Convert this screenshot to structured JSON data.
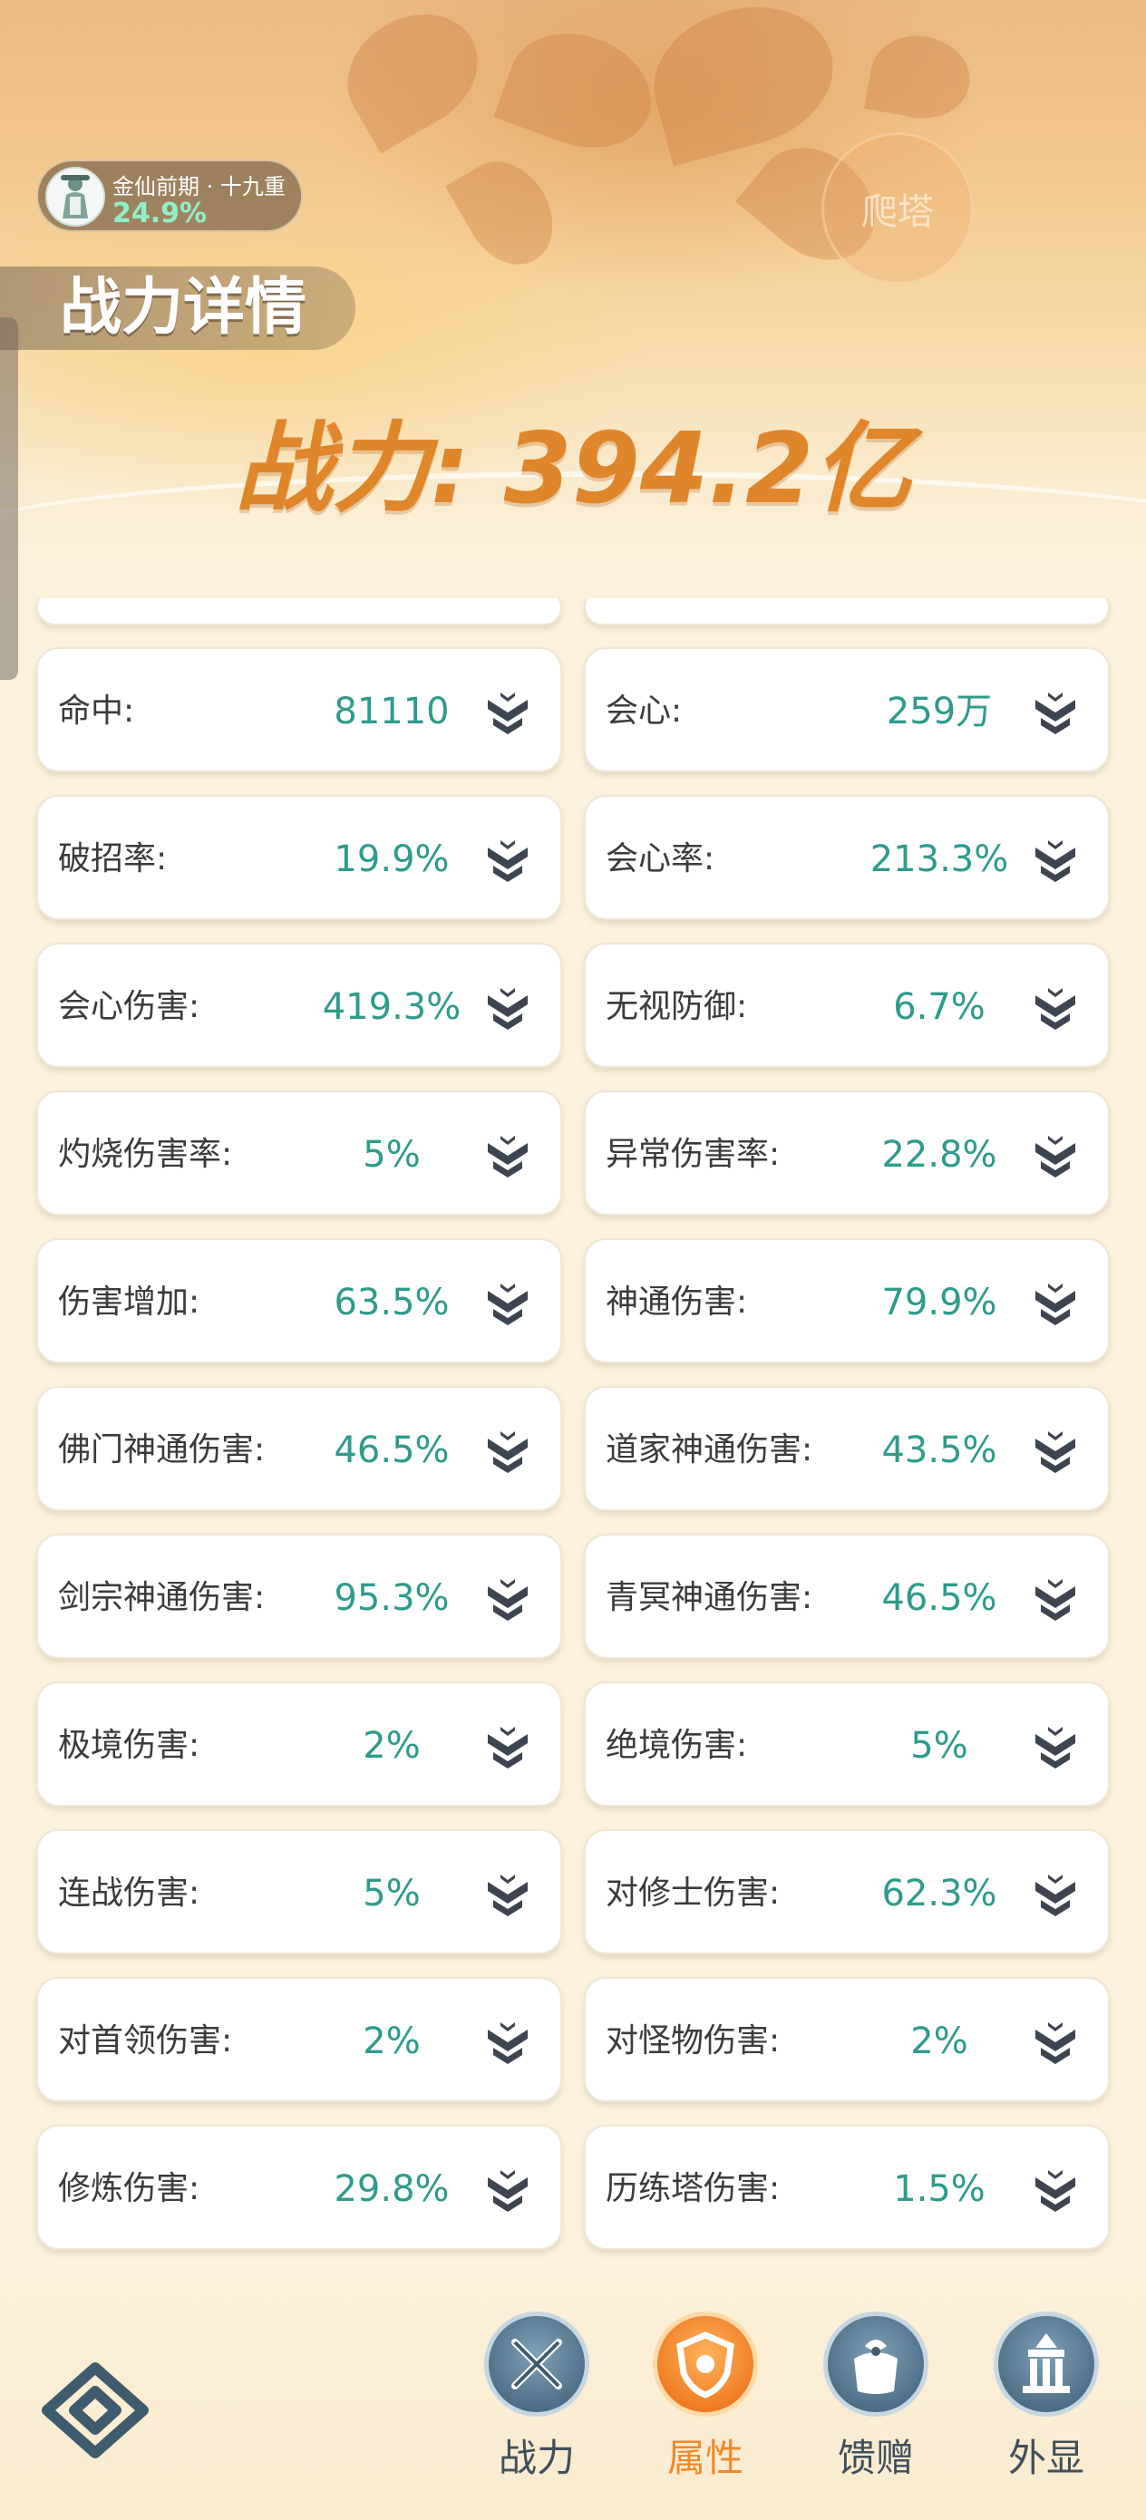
{
  "header": {
    "realm": {
      "title": "金仙前期 · 十九重",
      "progress": "24.9%"
    },
    "tower_button": "爬塔",
    "page_title": "战力详情",
    "power_label": "战力: 394.2亿"
  },
  "stats": [
    {
      "label": "命中:",
      "value": "81110"
    },
    {
      "label": "会心:",
      "value": "259万"
    },
    {
      "label": "破招率:",
      "value": "19.9%"
    },
    {
      "label": "会心率:",
      "value": "213.3%"
    },
    {
      "label": "会心伤害:",
      "value": "419.3%"
    },
    {
      "label": "无视防御:",
      "value": "6.7%"
    },
    {
      "label": "灼烧伤害率:",
      "value": "5%"
    },
    {
      "label": "异常伤害率:",
      "value": "22.8%"
    },
    {
      "label": "伤害增加:",
      "value": "63.5%"
    },
    {
      "label": "神通伤害:",
      "value": "79.9%"
    },
    {
      "label": "佛门神通伤害:",
      "value": "46.5%"
    },
    {
      "label": "道家神通伤害:",
      "value": "43.5%"
    },
    {
      "label": "剑宗神通伤害:",
      "value": "95.3%"
    },
    {
      "label": "青冥神通伤害:",
      "value": "46.5%"
    },
    {
      "label": "极境伤害:",
      "value": "2%"
    },
    {
      "label": "绝境伤害:",
      "value": "5%"
    },
    {
      "label": "连战伤害:",
      "value": "5%"
    },
    {
      "label": "对修士伤害:",
      "value": "62.3%"
    },
    {
      "label": "对首领伤害:",
      "value": "2%"
    },
    {
      "label": "对怪物伤害:",
      "value": "2%"
    },
    {
      "label": "修炼伤害:",
      "value": "29.8%"
    },
    {
      "label": "历练塔伤害:",
      "value": "1.5%"
    }
  ],
  "nav": {
    "items": [
      {
        "label": "战力",
        "icon": "crossed-swords-icon"
      },
      {
        "label": "属性",
        "icon": "shield-emblem-icon",
        "active": true
      },
      {
        "label": "馈赠",
        "icon": "gift-bag-icon"
      },
      {
        "label": "外显",
        "icon": "palace-icon"
      }
    ]
  },
  "colors": {
    "value_text": "#2e9b8b",
    "power_text": "#e0862a",
    "nav_active": "#f08a2c",
    "nav_icon": "#3f5b6e"
  }
}
